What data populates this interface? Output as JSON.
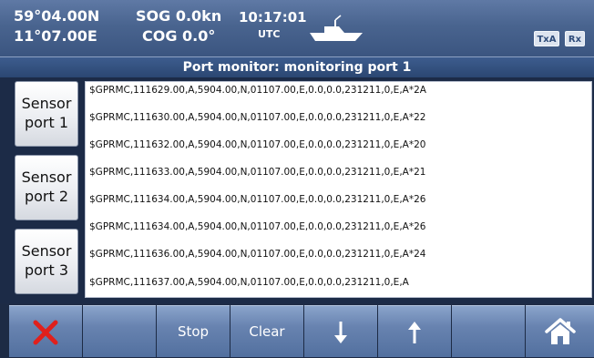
{
  "header": {
    "latitude": "59°04.00N",
    "longitude": "11°07.00E",
    "sog": "SOG 0.0kn",
    "cog": "COG 0.0°",
    "time": "10:17:01",
    "timezone": "UTC",
    "vessel_icon": "ship-icon",
    "tx_indicator": "TxA",
    "rx_indicator": "Rx"
  },
  "title": "Port monitor: monitoring port 1",
  "ports": [
    {
      "label": "Sensor\nport 1"
    },
    {
      "label": "Sensor\nport 2"
    },
    {
      "label": "Sensor\nport 3"
    }
  ],
  "monitor_lines": [
    "$GPRMC,111629.00,A,5904.00,N,01107.00,E,0.0,0.0,231211,0,E,A*2A",
    "$GPRMC,111630.00,A,5904.00,N,01107.00,E,0.0,0.0,231211,0,E,A*22",
    "$GPRMC,111632.00,A,5904.00,N,01107.00,E,0.0,0.0,231211,0,E,A*20",
    "$GPRMC,111633.00,A,5904.00,N,01107.00,E,0.0,0.0,231211,0,E,A*21",
    "$GPRMC,111634.00,A,5904.00,N,01107.00,E,0.0,0.0,231211,0,E,A*26",
    "$GPRMC,111634.00,A,5904.00,N,01107.00,E,0.0,0.0,231211,0,E,A*26",
    "$GPRMC,111636.00,A,5904.00,N,01107.00,E,0.0,0.0,231211,0,E,A*24",
    "$GPRMC,111637.00,A,5904.00,N,01107.00,E,0.0,0.0,231211,0,E,A"
  ],
  "toolbar": {
    "close_icon": "close-icon",
    "stop_label": "Stop",
    "clear_label": "Clear",
    "scroll_down_icon": "arrow-down-icon",
    "scroll_up_icon": "arrow-up-icon",
    "home_icon": "home-icon"
  },
  "colors": {
    "close_red": "#e0201c",
    "header_blue": "#4c6792",
    "toolbar_blue": "#6883b0"
  }
}
